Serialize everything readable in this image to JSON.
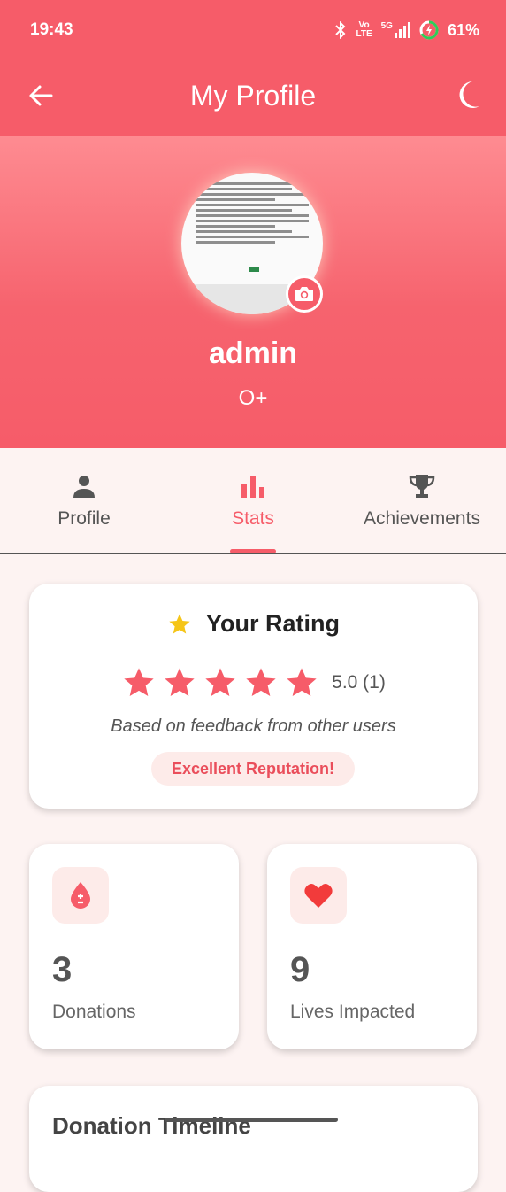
{
  "status_bar": {
    "time": "19:43",
    "volte_top": "Vo",
    "volte_bottom": "LTE",
    "network": "5G",
    "battery": "61%"
  },
  "app_bar": {
    "title": "My Profile",
    "back_icon": "arrow-left-icon",
    "theme_icon": "moon-icon"
  },
  "profile": {
    "username": "admin",
    "blood_type": "O+",
    "camera_icon": "camera-icon"
  },
  "tabs": [
    {
      "label": "Profile",
      "icon": "person-icon",
      "active": false
    },
    {
      "label": "Stats",
      "icon": "bar-chart-icon",
      "active": true
    },
    {
      "label": "Achievements",
      "icon": "trophy-icon",
      "active": false
    }
  ],
  "rating": {
    "title": "Your Rating",
    "stars": 5,
    "score": "5.0 (1)",
    "subtitle": "Based on feedback from other users",
    "badge": "Excellent Reputation!"
  },
  "stats": [
    {
      "value": "3",
      "label": "Donations",
      "icon": "blood-drop-icon"
    },
    {
      "value": "9",
      "label": "Lives Impacted",
      "icon": "heart-icon"
    }
  ],
  "timeline": {
    "title": "Donation Timeline"
  },
  "colors": {
    "primary": "#f65c69",
    "accent_light": "#fdebe9",
    "star": "#f5c518",
    "background": "#fdf3f2"
  }
}
